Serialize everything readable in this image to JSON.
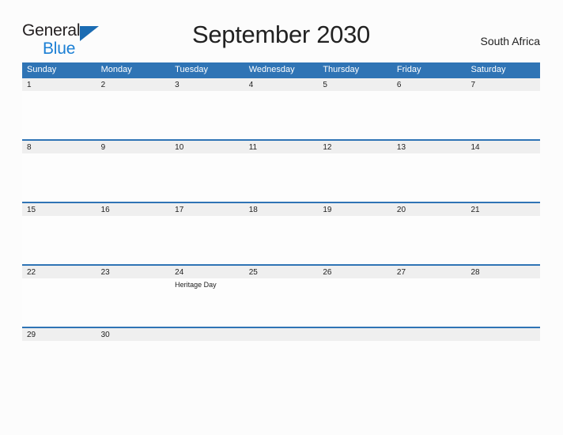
{
  "brand": {
    "word1": "General",
    "word2": "Blue",
    "flag_icon": "flag-triangle-icon",
    "color_dark": "#231f20",
    "color_blue": "#1b7fd4"
  },
  "header": {
    "title": "September 2030",
    "region": "South Africa"
  },
  "theme": {
    "header_blue": "#2f74b5",
    "band_gray": "#efefef",
    "page_bg": "#fcfcfc",
    "text": "#222222"
  },
  "calendar": {
    "weekdays": [
      "Sunday",
      "Monday",
      "Tuesday",
      "Wednesday",
      "Thursday",
      "Friday",
      "Saturday"
    ],
    "weeks": [
      {
        "days": [
          {
            "num": "1",
            "event": ""
          },
          {
            "num": "2",
            "event": ""
          },
          {
            "num": "3",
            "event": ""
          },
          {
            "num": "4",
            "event": ""
          },
          {
            "num": "5",
            "event": ""
          },
          {
            "num": "6",
            "event": ""
          },
          {
            "num": "7",
            "event": ""
          }
        ]
      },
      {
        "days": [
          {
            "num": "8",
            "event": ""
          },
          {
            "num": "9",
            "event": ""
          },
          {
            "num": "10",
            "event": ""
          },
          {
            "num": "11",
            "event": ""
          },
          {
            "num": "12",
            "event": ""
          },
          {
            "num": "13",
            "event": ""
          },
          {
            "num": "14",
            "event": ""
          }
        ]
      },
      {
        "days": [
          {
            "num": "15",
            "event": ""
          },
          {
            "num": "16",
            "event": ""
          },
          {
            "num": "17",
            "event": ""
          },
          {
            "num": "18",
            "event": ""
          },
          {
            "num": "19",
            "event": ""
          },
          {
            "num": "20",
            "event": ""
          },
          {
            "num": "21",
            "event": ""
          }
        ]
      },
      {
        "days": [
          {
            "num": "22",
            "event": ""
          },
          {
            "num": "23",
            "event": ""
          },
          {
            "num": "24",
            "event": "Heritage Day"
          },
          {
            "num": "25",
            "event": ""
          },
          {
            "num": "26",
            "event": ""
          },
          {
            "num": "27",
            "event": ""
          },
          {
            "num": "28",
            "event": ""
          }
        ]
      },
      {
        "days": [
          {
            "num": "29",
            "event": ""
          },
          {
            "num": "30",
            "event": ""
          },
          {
            "num": "",
            "event": ""
          },
          {
            "num": "",
            "event": ""
          },
          {
            "num": "",
            "event": ""
          },
          {
            "num": "",
            "event": ""
          },
          {
            "num": "",
            "event": ""
          }
        ]
      }
    ]
  }
}
